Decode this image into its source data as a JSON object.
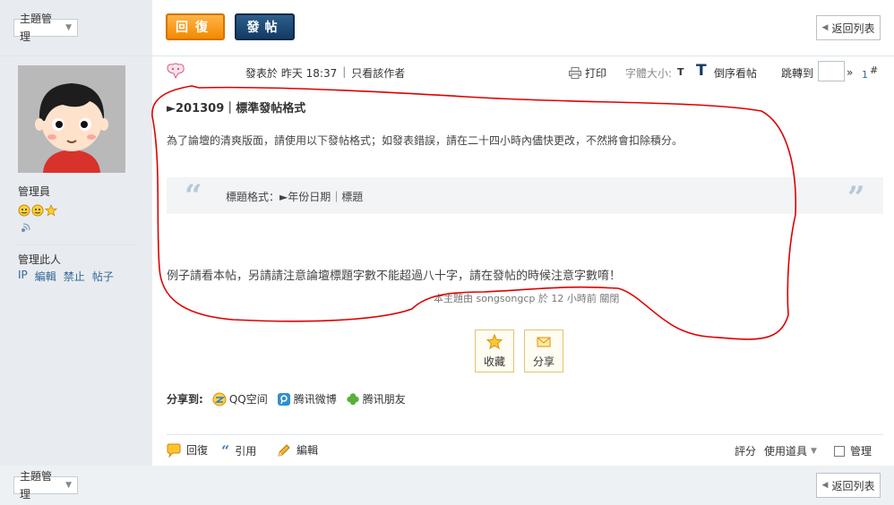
{
  "top": {
    "topic_manage_label": "主題管理",
    "reply_label": "回復",
    "post_label": "發帖",
    "back_label": "返回列表"
  },
  "user": {
    "role": "管理員",
    "manage_label": "管理此人",
    "manage_links": [
      "IP",
      "編輯",
      "禁止",
      "帖子"
    ]
  },
  "post_meta": {
    "posted_label": "發表於 昨天 18:37",
    "only_author": "只看該作者",
    "print_label": "打印",
    "font_size_label": "字體大小:",
    "font_size_t": "T",
    "reverse_label": "倒序看帖",
    "jump_label": "跳轉到",
    "next_arrow": "»",
    "floor": "1",
    "floor_hash": "#"
  },
  "post": {
    "title": "►201309｜標準發帖格式",
    "intro": "為了論壇的清爽版面，請使用以下發帖格式；如發表錯誤，請在二十四小時內儘快更改，不然將會扣除積分。",
    "quote_text": "標題格式：►年份日期｜標題",
    "example": "例子請看本帖，另請請注意論壇標題字數不能超過八十字，請在發帖的時候注意字數唷！",
    "closed_notice": "本主題由 songsongcp 於 12 小時前 關閉"
  },
  "actions": {
    "favorite": "收藏",
    "share": "分享"
  },
  "share_to": {
    "label": "分享到:",
    "items": [
      "QQ空间",
      "腾讯微博",
      "腾讯朋友"
    ]
  },
  "post_footer": {
    "reply": "回復",
    "quote": "引用",
    "edit": "編輯",
    "rate": "評分",
    "tools": "使用道具",
    "manage": "管理"
  },
  "bottom": {
    "topic_manage_label": "主題管理",
    "back_label": "返回列表"
  },
  "colors": {
    "reply_orange": "#f38a00",
    "post_navy": "#123b63",
    "annotation_red": "#e00000",
    "sidebar_bg": "#e8ecf0"
  }
}
